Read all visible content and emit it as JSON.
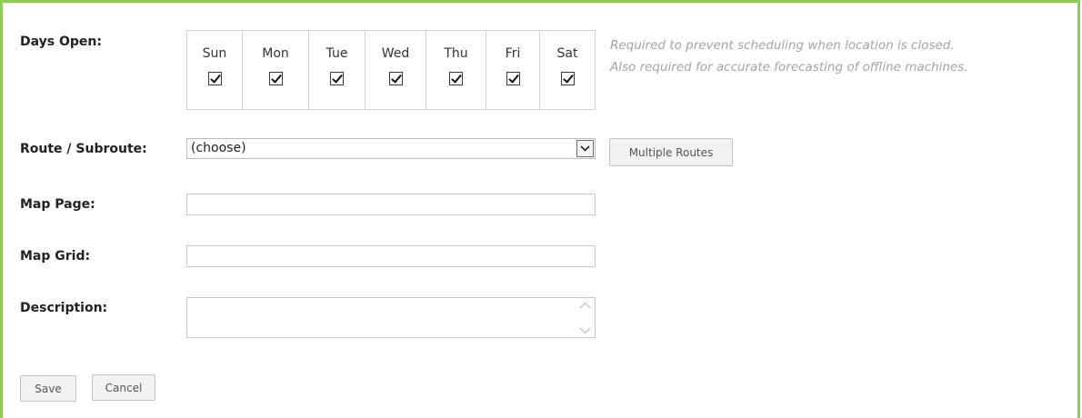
{
  "form": {
    "days_label": "Days Open:",
    "days": [
      {
        "name": "Sun",
        "checked": true
      },
      {
        "name": "Mon",
        "checked": true
      },
      {
        "name": "Tue",
        "checked": true
      },
      {
        "name": "Wed",
        "checked": true
      },
      {
        "name": "Thu",
        "checked": true
      },
      {
        "name": "Fri",
        "checked": true
      },
      {
        "name": "Sat",
        "checked": true
      }
    ],
    "days_hint_line1": "Required to prevent scheduling when location is closed.",
    "days_hint_line2": "Also required for accurate forecasting of offline machines.",
    "route_label": "Route / Subroute:",
    "route_value": "(choose)",
    "multiple_routes_label": "Multiple Routes",
    "map_page_label": "Map Page:",
    "map_page_value": "",
    "map_grid_label": "Map Grid:",
    "map_grid_value": "",
    "description_label": "Description:",
    "description_value": "",
    "save_label": "Save",
    "cancel_label": "Cancel"
  },
  "colors": {
    "frame_border": "#8dcc53",
    "hint_text": "#a4a4a4"
  }
}
